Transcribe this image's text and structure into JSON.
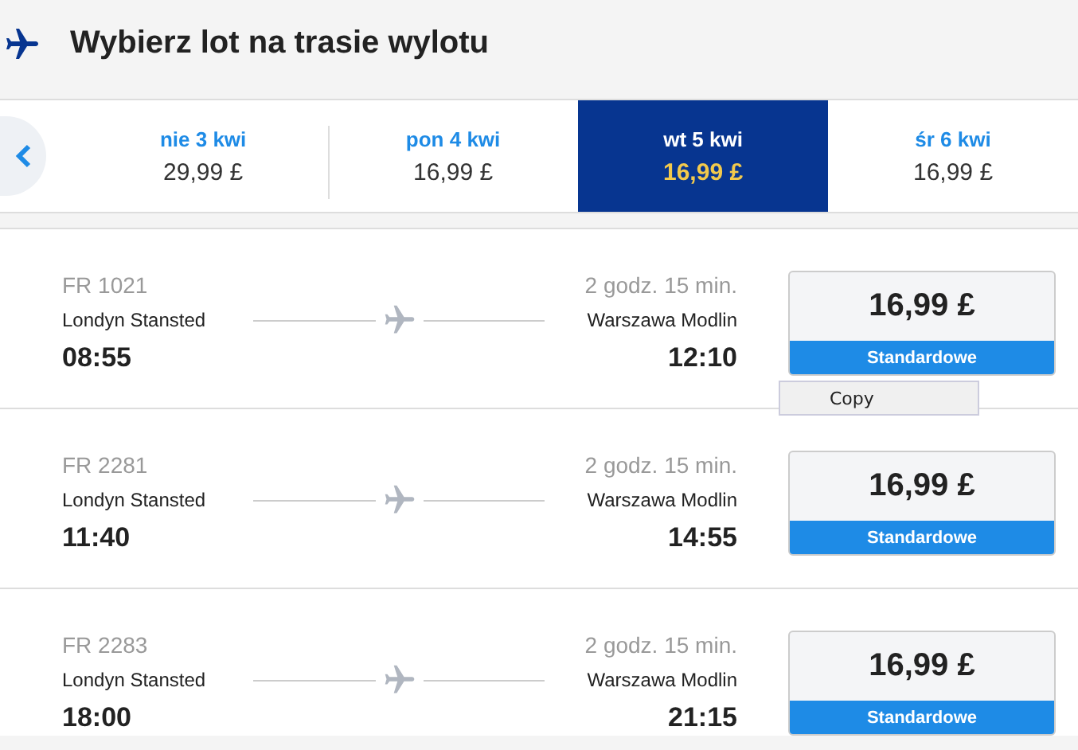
{
  "header": {
    "title": "Wybierz lot na trasie wylotu"
  },
  "date_tabs": [
    {
      "day": "nie 3 kwi",
      "price": "29,99 £",
      "selected": false
    },
    {
      "day": "pon 4 kwi",
      "price": "16,99 £",
      "selected": false
    },
    {
      "day": "wt 5 kwi",
      "price": "16,99 £",
      "selected": true
    },
    {
      "day": "śr 6 kwi",
      "price": "16,99 £",
      "selected": false
    }
  ],
  "flights": [
    {
      "number": "FR 1021",
      "duration": "2 godz. 15 min.",
      "from": "Londyn Stansted",
      "to": "Warszawa Modlin",
      "depart": "08:55",
      "arrive": "12:10",
      "price": "16,99 £",
      "fare": "Standardowe"
    },
    {
      "number": "FR 2281",
      "duration": "2 godz. 15 min.",
      "from": "Londyn Stansted",
      "to": "Warszawa Modlin",
      "depart": "11:40",
      "arrive": "14:55",
      "price": "16,99 £",
      "fare": "Standardowe"
    },
    {
      "number": "FR 2283",
      "duration": "2 godz. 15 min.",
      "from": "Londyn Stansted",
      "to": "Warszawa Modlin",
      "depart": "18:00",
      "arrive": "21:15",
      "price": "16,99 £",
      "fare": "Standardowe"
    }
  ],
  "context_menu": {
    "items": [
      "Copy"
    ]
  }
}
